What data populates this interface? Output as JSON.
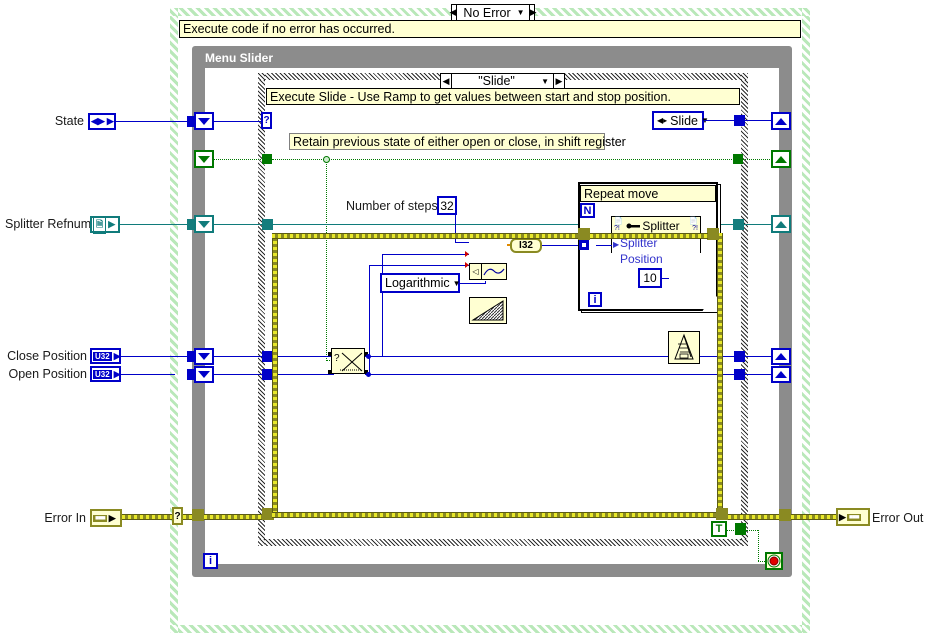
{
  "diagram": {
    "type": "labview-block-diagram",
    "outer_case": {
      "selector_value": "No Error",
      "comment": "Execute code if no error has occurred."
    },
    "while_loop": {
      "title": "Menu Slider"
    },
    "inner_case": {
      "selector_value": "\"Slide\"",
      "comment": "Execute Slide - Use Ramp to get values between start and stop position."
    },
    "comments": {
      "retain_state": "Retain previous state of either open or close, in shift register"
    },
    "controls": {
      "state": {
        "label": "State",
        "terminal_glyph": "◀▶"
      },
      "splitter_refnum": {
        "label": "Splitter Refnum",
        "terminal_glyph": "⬜"
      },
      "close_position": {
        "label": "Close Position",
        "terminal_glyph": "U32"
      },
      "open_position": {
        "label": "Open Position",
        "terminal_glyph": "U32"
      },
      "error_in": {
        "label": "Error In",
        "terminal_glyph": "err"
      },
      "error_out": {
        "label": "Error Out",
        "terminal_glyph": "err"
      }
    },
    "nodes": {
      "number_of_steps": {
        "label": "Number of steps",
        "value": "32"
      },
      "ramp_function": {
        "name": "ramp-pattern-vi",
        "output_type": "I32"
      },
      "ramp_type": {
        "value": "Logarithmic"
      },
      "slide_enum": {
        "value": "Slide"
      },
      "select_node": {
        "name": "select-swap-node",
        "glyph": "?"
      },
      "for_loop": {
        "title": "Repeat move",
        "count_glyph": "N",
        "iteration_glyph": "i"
      },
      "splitter_subvi": {
        "title": "Splitter",
        "input_label": "Splitter Position"
      },
      "wait_ms": {
        "value": "10",
        "name": "wait-ms-metronome"
      },
      "true_constant": {
        "value": "T"
      },
      "stop_terminal": {
        "name": "loop-stop-condition"
      },
      "while_iteration": {
        "glyph": "i"
      }
    },
    "colors": {
      "wire_blue": "#0000c8",
      "wire_teal": "#107b7b",
      "wire_green": "#007800",
      "wire_error": "#8a8a22",
      "comment_bg": "#ffffd2",
      "loop_gray": "#8c8c8c",
      "error_case_green": "#b9e8b9",
      "subvi_link_blue": "#3333cc"
    }
  }
}
